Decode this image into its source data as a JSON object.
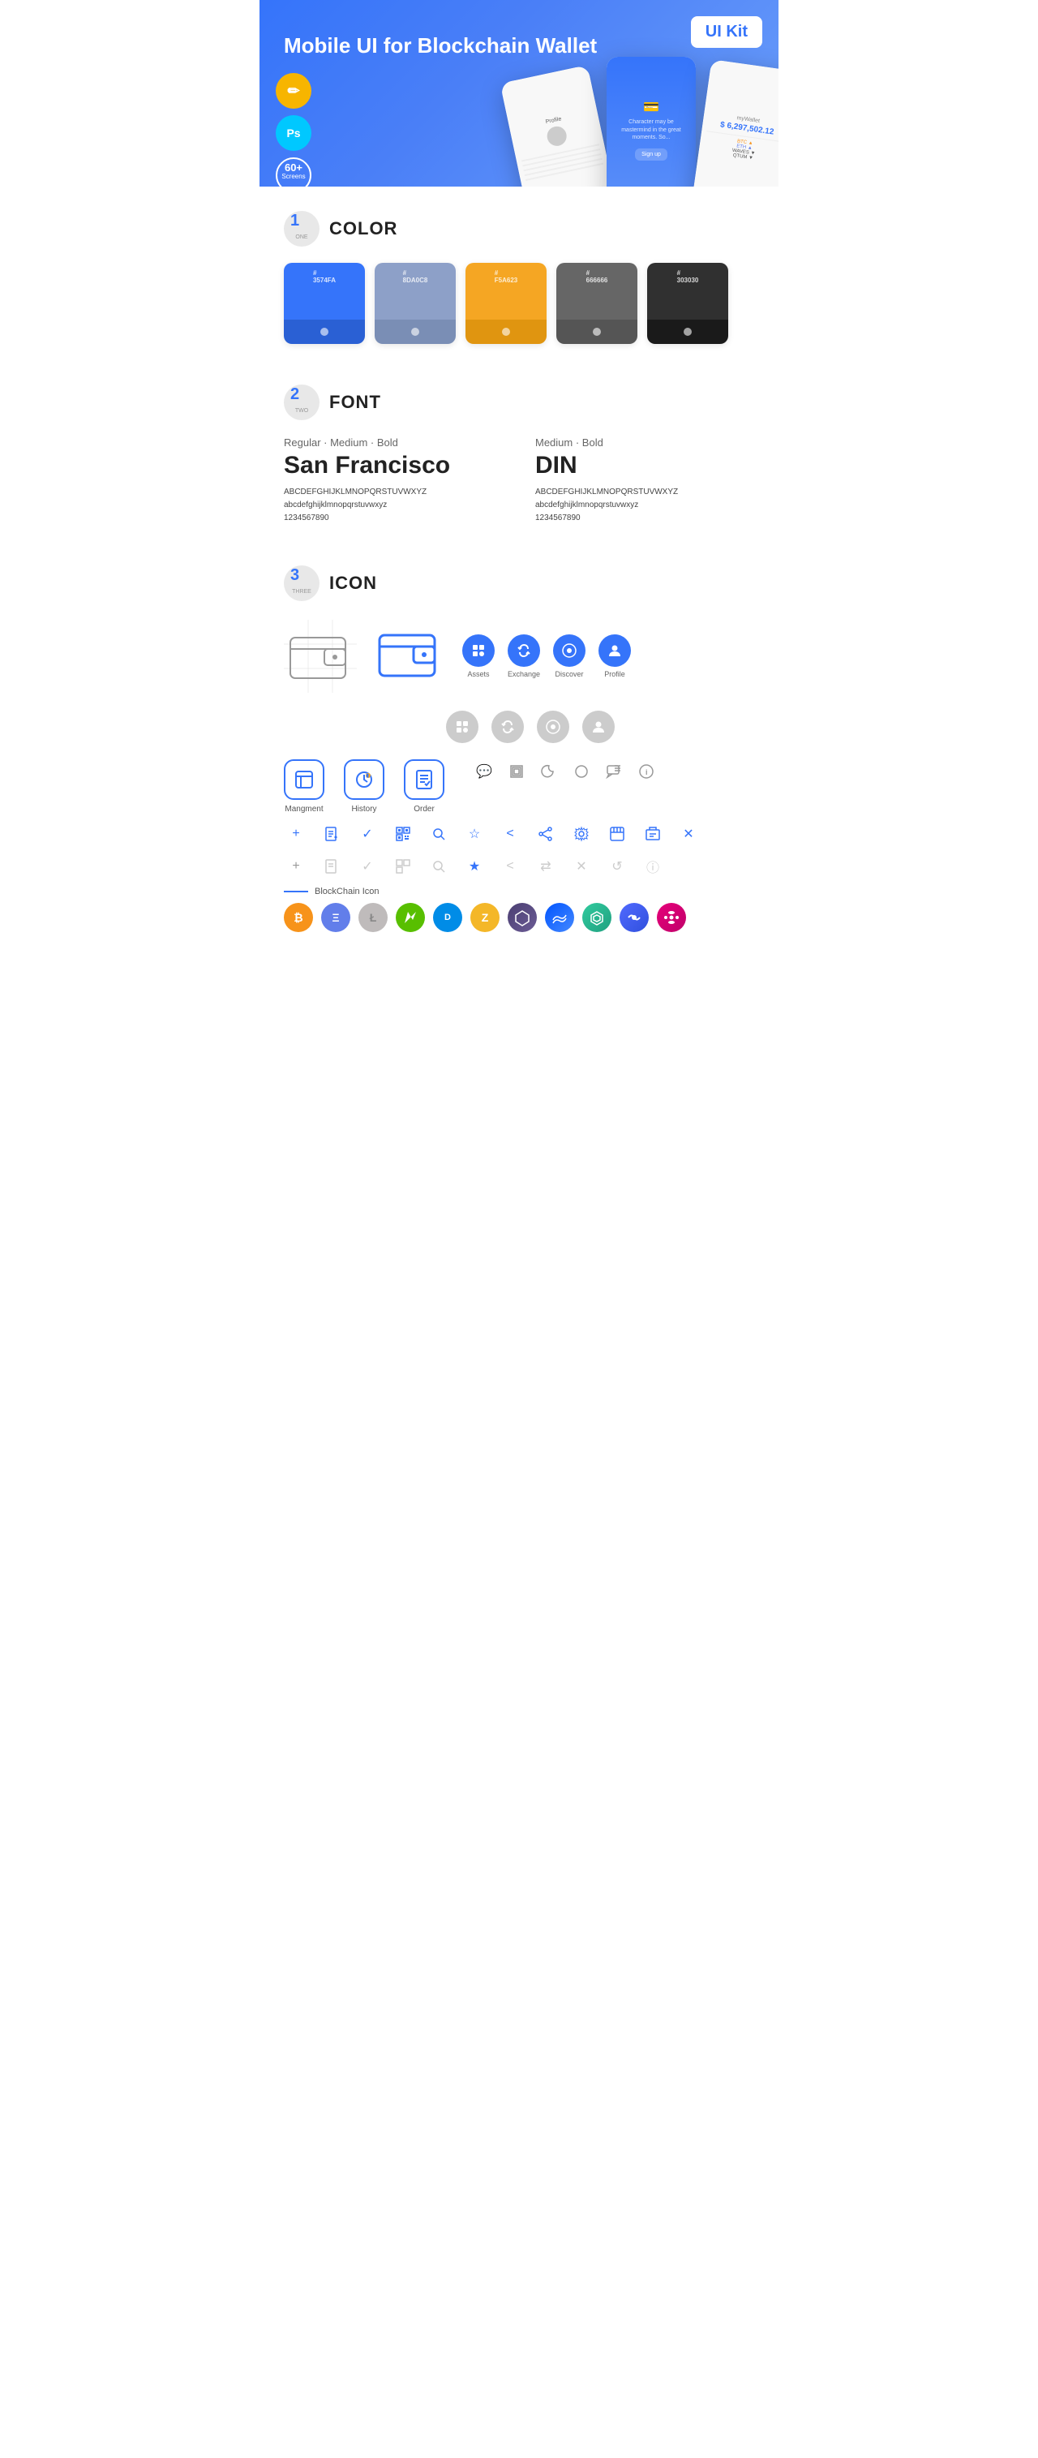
{
  "hero": {
    "title": "Mobile UI for Blockchain ",
    "title_bold": "Wallet",
    "badge": "UI Kit",
    "badge_sketch": "Sk",
    "badge_ps": "Ps",
    "badge_screens_line1": "60+",
    "badge_screens_line2": "Screens"
  },
  "section1": {
    "number": "1",
    "word": "ONE",
    "title": "COLOR",
    "colors": [
      {
        "hex": "#3574FA",
        "code": "#\n3574FA"
      },
      {
        "hex": "#8DA0C8",
        "code": "#\n8DA0C8"
      },
      {
        "hex": "#F5A623",
        "code": "#\nF5A623"
      },
      {
        "hex": "#666666",
        "code": "#\n666666"
      },
      {
        "hex": "#303030",
        "code": "#\n303030"
      }
    ]
  },
  "section2": {
    "number": "2",
    "word": "TWO",
    "title": "FONT",
    "font1": {
      "style": "Regular · Medium · Bold",
      "name": "San Francisco",
      "uppercase": "ABCDEFGHIJKLMNOPQRSTUVWXYZ",
      "lowercase": "abcdefghijklmnopqrstuvwxyz",
      "numbers": "1234567890"
    },
    "font2": {
      "style": "Medium · Bold",
      "name": "DIN",
      "uppercase": "ABCDEFGHIJKLMNOPQRSTUVWXYZ",
      "lowercase": "abcdefghijklmnopqrstuvwxyz",
      "numbers": "1234567890"
    }
  },
  "section3": {
    "number": "3",
    "word": "THREE",
    "title": "ICON",
    "nav_icons": [
      {
        "label": "Assets",
        "color": "#3574FA"
      },
      {
        "label": "Exchange",
        "color": "#3574FA"
      },
      {
        "label": "Discover",
        "color": "#3574FA"
      },
      {
        "label": "Profile",
        "color": "#3574FA"
      }
    ],
    "nav_icons2": [
      {
        "label": "Assets",
        "color": "#ccc"
      },
      {
        "label": "Exchange",
        "color": "#ccc"
      },
      {
        "label": "Discover",
        "color": "#ccc"
      },
      {
        "label": "Profile",
        "color": "#ccc"
      }
    ],
    "app_icons": [
      {
        "label": "Mangment"
      },
      {
        "label": "History"
      },
      {
        "label": "Order"
      }
    ],
    "blockchain_label": "BlockChain Icon",
    "crypto": [
      {
        "symbol": "₿",
        "label": "BTC",
        "class": "crypto-btc"
      },
      {
        "symbol": "Ξ",
        "label": "ETH",
        "class": "crypto-eth"
      },
      {
        "symbol": "Ł",
        "label": "LTC",
        "class": "crypto-ltc"
      },
      {
        "symbol": "N",
        "label": "NEO",
        "class": "crypto-neo"
      },
      {
        "symbol": "D",
        "label": "DASH",
        "class": "crypto-dash"
      },
      {
        "symbol": "Z",
        "label": "ZEC",
        "class": "crypto-zcash"
      },
      {
        "symbol": "◆",
        "label": "POLY",
        "class": "crypto-poly"
      },
      {
        "symbol": "W",
        "label": "WAVES",
        "class": "crypto-waves"
      },
      {
        "symbol": "K",
        "label": "KNC",
        "class": "crypto-kyber"
      },
      {
        "symbol": "B",
        "label": "BAND",
        "class": "crypto-band"
      },
      {
        "symbol": "●",
        "label": "DOT",
        "class": "crypto-dot"
      }
    ]
  }
}
